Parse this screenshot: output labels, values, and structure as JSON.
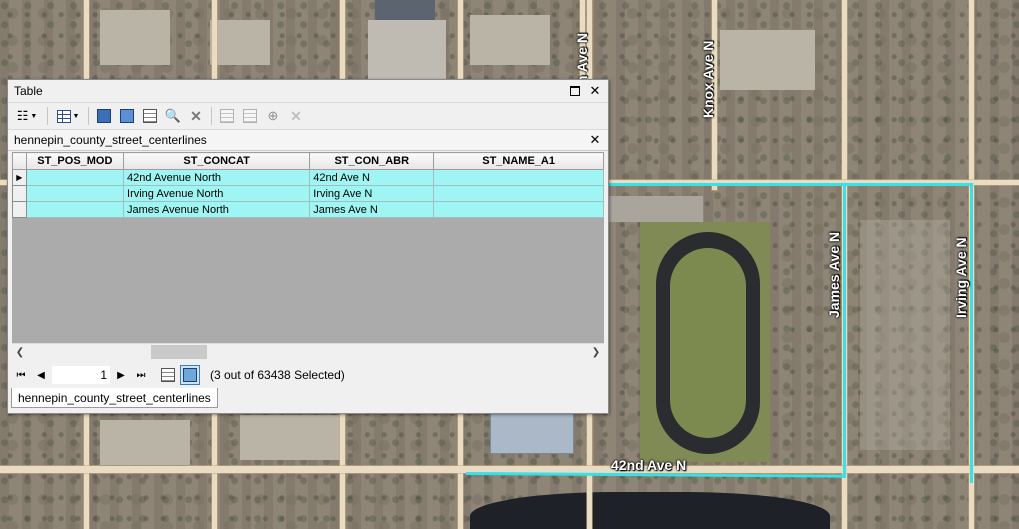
{
  "map": {
    "labels": {
      "knox": "Knox Ave N",
      "james": "James Ave N",
      "irving": "Irving Ave N",
      "forty_second": "42nd Ave N",
      "partial_top": "n Ave N"
    },
    "selection_color": "#39e0e6"
  },
  "window": {
    "title": "Table",
    "maximize_icon": "maximize-icon",
    "close_glyph": "✕"
  },
  "toolbar": {
    "icons": [
      "table-options-icon",
      "related-tables-icon",
      "select-by-attributes-icon",
      "switch-selection-icon",
      "clear-selection-icon",
      "zoom-to-selected-icon",
      "delete-selected-icon",
      "copy-selected-icon",
      "paste-icon",
      "add-icon",
      "remove-icon"
    ]
  },
  "layer_tab": {
    "title": "hennepin_county_street_centerlines",
    "close_glyph": "✕"
  },
  "table": {
    "columns": [
      "ST_POS_MOD",
      "ST_CONCAT",
      "ST_CON_ABR",
      "ST_NAME_A1"
    ],
    "rows": [
      {
        "current": "▶",
        "st_pos_mod": "",
        "st_concat": "42nd Avenue North",
        "st_con_abr": "42nd Ave N",
        "st_name_a1": ""
      },
      {
        "current": "",
        "st_pos_mod": "",
        "st_concat": "Irving Avenue North",
        "st_con_abr": "Irving Ave N",
        "st_name_a1": ""
      },
      {
        "current": "",
        "st_pos_mod": "",
        "st_concat": "James Avenue North",
        "st_con_abr": "James Ave N",
        "st_name_a1": ""
      }
    ],
    "selected_color": "#9ff5f3"
  },
  "navigation": {
    "record": "1",
    "selection_status": "(3 out of 63438 Selected)"
  },
  "bottom_tab": {
    "label": "hennepin_county_street_centerlines"
  }
}
